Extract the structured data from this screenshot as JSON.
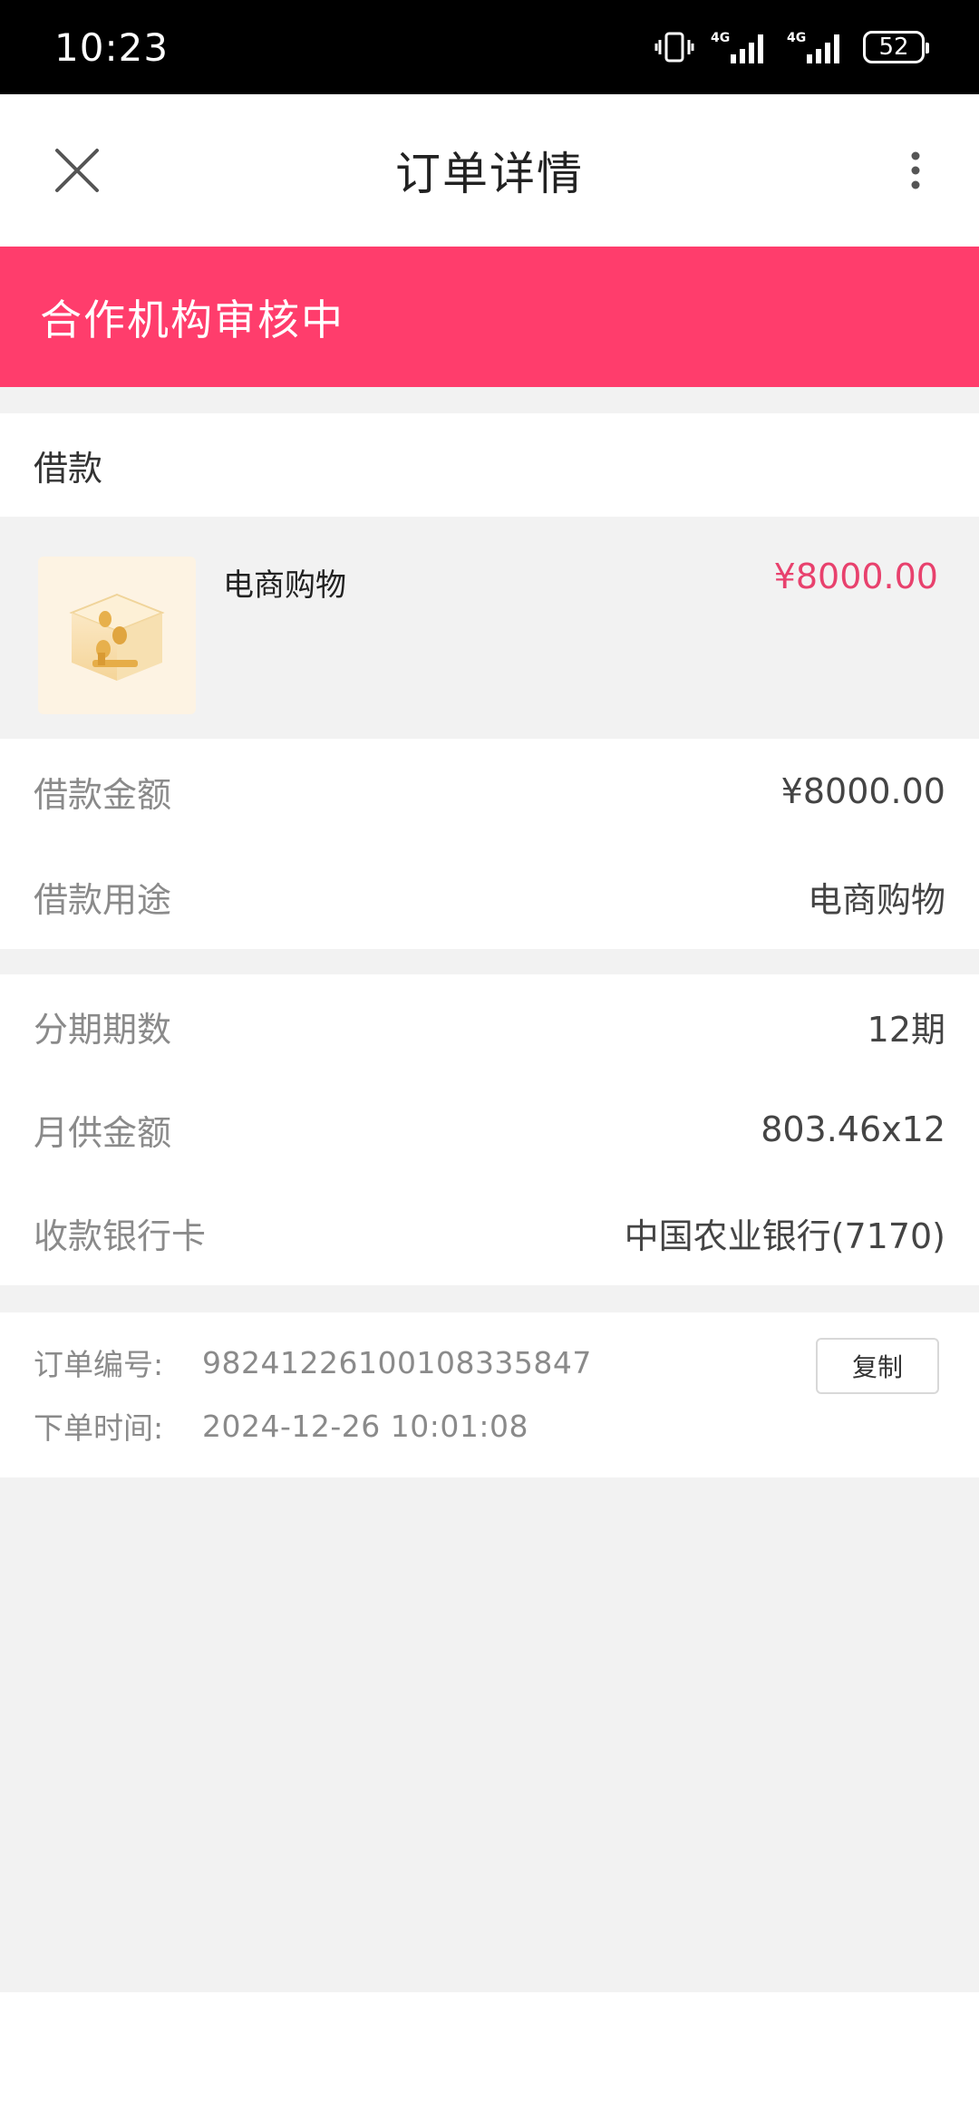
{
  "status_bar": {
    "time": "10:23",
    "battery": "52"
  },
  "header": {
    "title": "订单详情"
  },
  "banner": {
    "status_text": "合作机构审核中"
  },
  "loan_section": {
    "heading": "借款"
  },
  "product": {
    "name": "电商购物",
    "price": "¥8000.00"
  },
  "loan_details": [
    {
      "label": "借款金额",
      "value": "¥8000.00"
    },
    {
      "label": "借款用途",
      "value": "电商购物"
    }
  ],
  "repayment_details": [
    {
      "label": "分期期数",
      "value": "12期"
    },
    {
      "label": "月供金额",
      "value": "803.46x12"
    },
    {
      "label": "收款银行卡",
      "value": "中国农业银行(7170)"
    }
  ],
  "order": {
    "number_label": "订单编号:",
    "number_value": "9824122610010833​5847",
    "time_label": "下单时间:",
    "time_value": "2024-12-26 10:01:08",
    "copy_label": "复制"
  },
  "colors": {
    "accent": "#ff3d6c",
    "price": "#e8416d"
  },
  "icons": {
    "close": "close-icon",
    "more": "more-vertical-icon",
    "thumb": "coin-box-icon"
  }
}
